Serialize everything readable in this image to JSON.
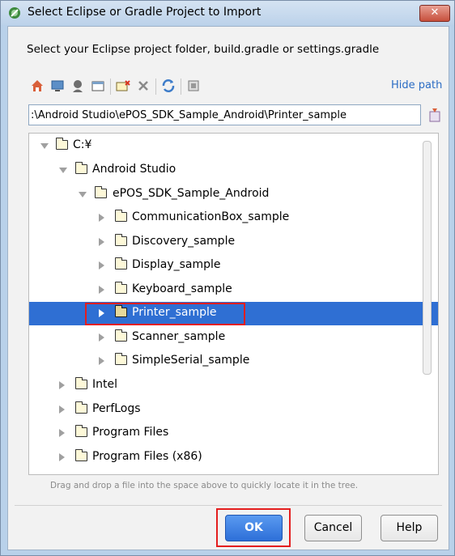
{
  "window": {
    "title": "Select Eclipse or Gradle Project to Import",
    "close_label": "✕",
    "prompt": "Select your Eclipse project folder, build.gradle or settings.gradle"
  },
  "toolbar": {
    "icons": [
      "home-icon",
      "desktop-icon",
      "user-home-icon",
      "project-icon",
      "new-folder-icon",
      "delete-icon",
      "refresh-icon",
      "show-hidden-icon"
    ],
    "hide_path_label": "Hide path"
  },
  "path_field": {
    "value": ":\\Android Studio\\ePOS_SDK_Sample_Android\\Printer_sample"
  },
  "tree": {
    "items": [
      {
        "label": "C:¥",
        "expanded": true
      },
      {
        "label": "Android Studio",
        "expanded": true
      },
      {
        "label": "ePOS_SDK_Sample_Android",
        "expanded": true
      },
      {
        "label": "CommunicationBox_sample",
        "expanded": false
      },
      {
        "label": "Discovery_sample",
        "expanded": false
      },
      {
        "label": "Display_sample",
        "expanded": false
      },
      {
        "label": "Keyboard_sample",
        "expanded": false
      },
      {
        "label": "Printer_sample",
        "expanded": false,
        "selected": true
      },
      {
        "label": "Scanner_sample",
        "expanded": false
      },
      {
        "label": "SimpleSerial_sample",
        "expanded": false
      },
      {
        "label": "Intel",
        "expanded": false
      },
      {
        "label": "PerfLogs",
        "expanded": false
      },
      {
        "label": "Program Files",
        "expanded": false
      },
      {
        "label": "Program Files (x86)",
        "expanded": false
      }
    ]
  },
  "hint": "Drag and drop a file into the space above to quickly locate it in the tree.",
  "buttons": {
    "ok": "OK",
    "cancel": "Cancel",
    "help": "Help"
  },
  "colors": {
    "selection": "#2f6fd3",
    "highlight": "#e41e1e",
    "link": "#2b6cc4"
  }
}
